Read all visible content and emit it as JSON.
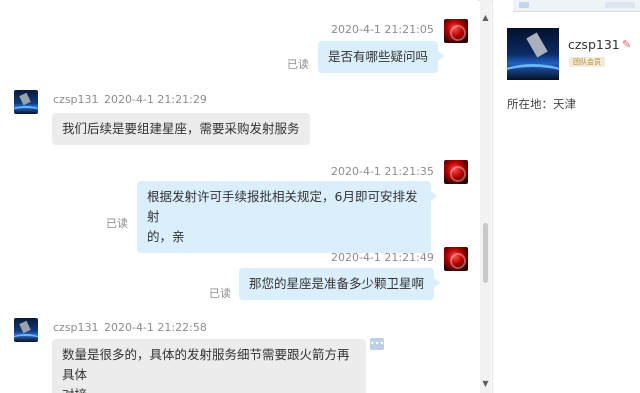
{
  "messages": [
    {
      "time": "2020-4-1 21:21:05",
      "text": "是否有哪些疑问吗",
      "status": "已读"
    },
    {
      "sender": "czsp131",
      "time": "2020-4-1 21:21:29",
      "text": "我们后续是要组建星座，需要采购发射服务"
    },
    {
      "time": "2020-4-1 21:21:35",
      "text_line1": "根据发射许可手续报批相关规定，6月即可安排发射",
      "text_line2": "的，亲",
      "status": "已读"
    },
    {
      "time": "2020-4-1 21:21:49",
      "text": "那您的星座是准备多少颗卫星啊",
      "status": "已读"
    },
    {
      "sender": "czsp131",
      "time": "2020-4-1 21:22:58",
      "text_line1": "数量是很多的，具体的发射服务细节需要跟火箭方再具体",
      "text_line2": "对接"
    }
  ],
  "profile": {
    "name": "czsp131",
    "badge": "团队会员",
    "location": "所在地：天津"
  },
  "icons": {
    "scroll_up": "▲",
    "scroll_down": "▼",
    "edit": "✎",
    "more": "•••"
  }
}
